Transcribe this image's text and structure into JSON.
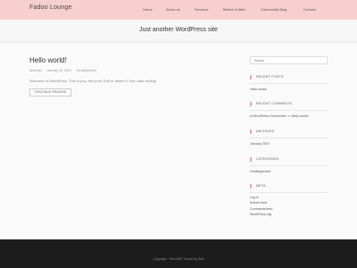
{
  "header": {
    "site_title": "Fadoo Lounge",
    "nav": [
      "Home",
      "About us",
      "Services",
      "Before & After",
      "Community Blog",
      "Contact"
    ]
  },
  "banner": {
    "tagline": "Just another WordPress site"
  },
  "post": {
    "title": "Hello world!",
    "author": "fanoertin",
    "date": "January 29, 2019",
    "category": "Uncategorized",
    "excerpt": "Welcome to WordPress. This is your first post. Edit or delete it, then start writing!",
    "read_more": "CONTINUE READING"
  },
  "sidebar": {
    "search_placeholder": "Search",
    "recent_posts": {
      "title": "RECENT POSTS",
      "items": [
        "Hello world!"
      ]
    },
    "recent_comments": {
      "title": "RECENT COMMENTS",
      "author": "A WordPress Commenter",
      "on": "on",
      "post": "Hello world!"
    },
    "archives": {
      "title": "ARCHIVES",
      "items": [
        "January 2019"
      ]
    },
    "categories": {
      "title": "CATEGORIES",
      "items": [
        "Uncategorized"
      ]
    },
    "meta": {
      "title": "META",
      "items": [
        "Log in",
        "Entries feed",
        "Comments feed",
        "WordPress.org"
      ]
    }
  },
  "footer": {
    "text": "Copyright · OnionWP Theme by Rad"
  },
  "colors": {
    "header_bg": "#f7cfcf",
    "accent": "#e9a6a6",
    "footer_bg": "#1c1c1c"
  }
}
